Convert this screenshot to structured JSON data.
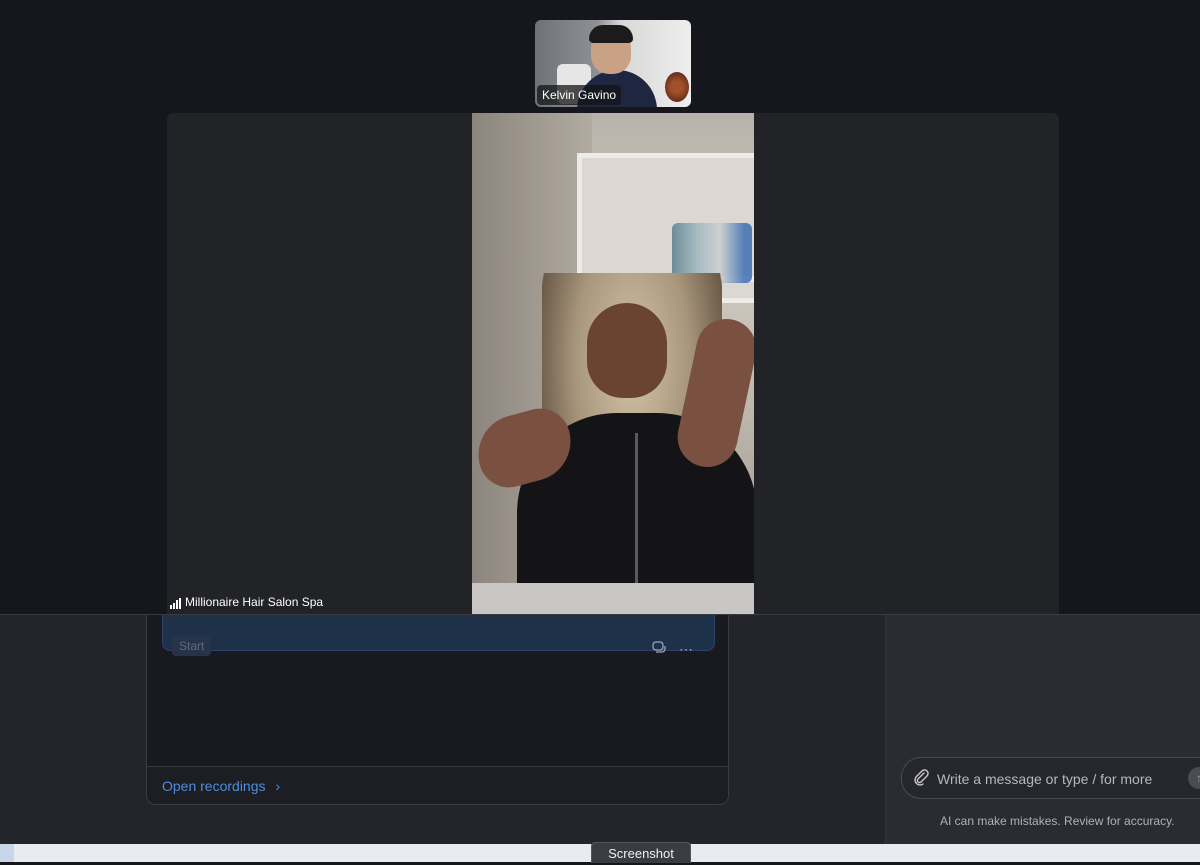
{
  "meeting": {
    "thumbnail": {
      "name": "Kelvin Gavino"
    },
    "main_video": {
      "name": "Millionaire Hair Salon Spa",
      "signal": "strong"
    }
  },
  "recordings": {
    "start_label": "Start",
    "open_link": "Open recordings",
    "chevron": "›",
    "row_icons": [
      "chat-bubbles-icon",
      "more-options-icon"
    ]
  },
  "assistant": {
    "message_placeholder": "Write a message or type / for more",
    "disclaimer": "AI can make mistakes. Review for accuracy."
  },
  "taskbar": {
    "screenshot_label": "Screenshot"
  },
  "colors": {
    "accent": "#4d8dde",
    "background": "#16171b",
    "stage": "#222326"
  }
}
